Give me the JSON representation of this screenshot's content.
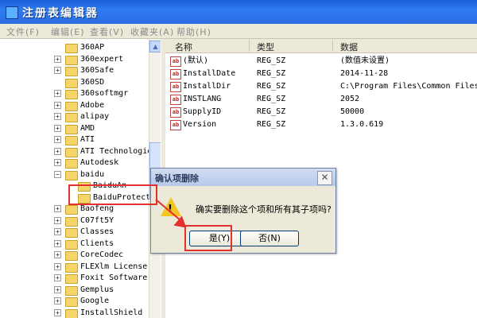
{
  "window": {
    "title": "注册表编辑器"
  },
  "menu": [
    "文件(F)",
    "编辑(E)",
    "查看(V)",
    "收藏夹(A)",
    "帮助(H)"
  ],
  "tree": [
    {
      "label": "360AP",
      "expander": false
    },
    {
      "label": "360expert",
      "expander": true
    },
    {
      "label": "360Safe",
      "expander": true
    },
    {
      "label": "360SD",
      "expander": false
    },
    {
      "label": "360softmgr",
      "expander": true
    },
    {
      "label": "Adobe",
      "expander": true
    },
    {
      "label": "alipay",
      "expander": true
    },
    {
      "label": "AMD",
      "expander": true
    },
    {
      "label": "ATI",
      "expander": true
    },
    {
      "label": "ATI Technologies",
      "expander": true
    },
    {
      "label": "Autodesk",
      "expander": true
    },
    {
      "label": "baidu",
      "expander": true,
      "expanded": true
    },
    {
      "label": "BaiduAn",
      "expander": false,
      "child": true
    },
    {
      "label": "BaiduProtect",
      "expander": false,
      "child": true,
      "selected": true
    },
    {
      "label": "Baofeng",
      "expander": true
    },
    {
      "label": "C07ft5Y",
      "expander": true
    },
    {
      "label": "Classes",
      "expander": true
    },
    {
      "label": "Clients",
      "expander": true
    },
    {
      "label": "CoreCodec",
      "expander": true
    },
    {
      "label": "FLEXlm License M",
      "expander": true
    },
    {
      "label": "Foxit Software",
      "expander": true
    },
    {
      "label": "Gemplus",
      "expander": true
    },
    {
      "label": "Google",
      "expander": true
    },
    {
      "label": "InstallShield",
      "expander": true
    }
  ],
  "columns": {
    "name": "名称",
    "type": "类型",
    "data": "数据"
  },
  "values": [
    {
      "name": "(默认)",
      "type": "REG_SZ",
      "data": "(数值未设置)"
    },
    {
      "name": "InstallDate",
      "type": "REG_SZ",
      "data": "2014-11-28"
    },
    {
      "name": "InstallDir",
      "type": "REG_SZ",
      "data": "C:\\Program Files\\Common Files\\B"
    },
    {
      "name": "INSTLANG",
      "type": "REG_SZ",
      "data": "2052"
    },
    {
      "name": "SupplyID",
      "type": "REG_SZ",
      "data": "50000"
    },
    {
      "name": "Version",
      "type": "REG_SZ",
      "data": "1.3.0.619"
    }
  ],
  "dialog": {
    "title": "确认项删除",
    "message": "确实要删除这个项和所有其子项吗?",
    "yes_label": "是(Y)",
    "no_label": "否(N)",
    "close_glyph": "✕",
    "icon": "warning-icon"
  },
  "colors": {
    "title_bar": "#2a6de3",
    "annotation": "#e53030",
    "folder": "#f5d56a"
  }
}
